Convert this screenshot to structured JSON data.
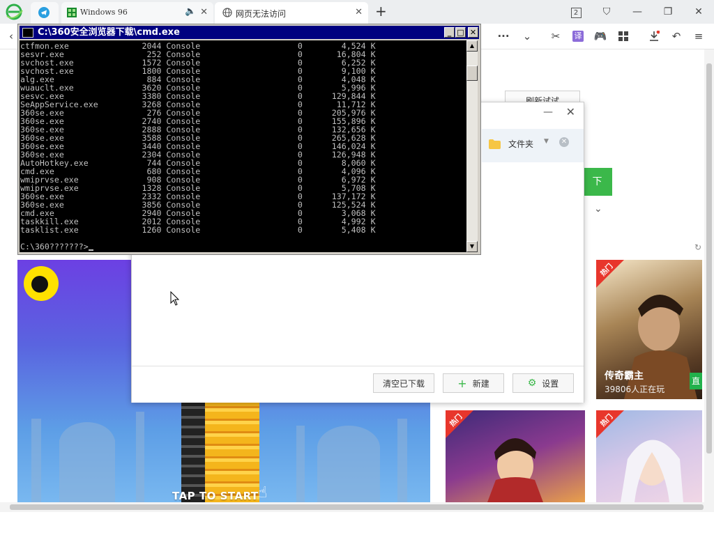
{
  "browser": {
    "tabs": [
      {
        "label": "",
        "icon": "telegram-icon"
      },
      {
        "label": "Windows 96",
        "icon": "win96-icon"
      },
      {
        "label": "网页无法访问",
        "icon": "globe-icon"
      }
    ],
    "tab_count_badge": "2"
  },
  "page": {
    "refresh_label": "刷新试试",
    "green_button_label": "下",
    "game": {
      "tap_label": "TAP TO START"
    },
    "cards": [
      {
        "badge": "热门",
        "title": "传奇霸主",
        "subtitle": "39806人正在玩",
        "tag": "直"
      },
      {
        "badge": "热门"
      },
      {
        "badge": "热门"
      }
    ]
  },
  "download_dialog": {
    "folder_label": "文件夹",
    "clear_button": "清空已下载",
    "new_button": "新建",
    "settings_button": "设置"
  },
  "cmd": {
    "title": "C:\\360安全浏览器下载\\cmd.exe",
    "rows": [
      {
        "name": "ctfmon.exe",
        "pid": "2044",
        "session": "Console",
        "num": "0",
        "mem": "4,524 K"
      },
      {
        "name": "sesvr.exe",
        "pid": "252",
        "session": "Console",
        "num": "0",
        "mem": "16,804 K"
      },
      {
        "name": "svchost.exe",
        "pid": "1572",
        "session": "Console",
        "num": "0",
        "mem": "6,252 K"
      },
      {
        "name": "svchost.exe",
        "pid": "1800",
        "session": "Console",
        "num": "0",
        "mem": "9,100 K"
      },
      {
        "name": "alg.exe",
        "pid": "884",
        "session": "Console",
        "num": "0",
        "mem": "4,048 K"
      },
      {
        "name": "wuauclt.exe",
        "pid": "3620",
        "session": "Console",
        "num": "0",
        "mem": "5,996 K"
      },
      {
        "name": "sesvc.exe",
        "pid": "3380",
        "session": "Console",
        "num": "0",
        "mem": "129,844 K"
      },
      {
        "name": "SeAppService.exe",
        "pid": "3268",
        "session": "Console",
        "num": "0",
        "mem": "11,712 K"
      },
      {
        "name": "360se.exe",
        "pid": "276",
        "session": "Console",
        "num": "0",
        "mem": "205,976 K"
      },
      {
        "name": "360se.exe",
        "pid": "2740",
        "session": "Console",
        "num": "0",
        "mem": "155,896 K"
      },
      {
        "name": "360se.exe",
        "pid": "2888",
        "session": "Console",
        "num": "0",
        "mem": "132,656 K"
      },
      {
        "name": "360se.exe",
        "pid": "3588",
        "session": "Console",
        "num": "0",
        "mem": "265,628 K"
      },
      {
        "name": "360se.exe",
        "pid": "3440",
        "session": "Console",
        "num": "0",
        "mem": "146,024 K"
      },
      {
        "name": "360se.exe",
        "pid": "2304",
        "session": "Console",
        "num": "0",
        "mem": "126,948 K"
      },
      {
        "name": "AutoHotkey.exe",
        "pid": "744",
        "session": "Console",
        "num": "0",
        "mem": "8,060 K"
      },
      {
        "name": "cmd.exe",
        "pid": "680",
        "session": "Console",
        "num": "0",
        "mem": "4,096 K"
      },
      {
        "name": "wmiprvse.exe",
        "pid": "908",
        "session": "Console",
        "num": "0",
        "mem": "6,972 K"
      },
      {
        "name": "wmiprvse.exe",
        "pid": "1328",
        "session": "Console",
        "num": "0",
        "mem": "5,708 K"
      },
      {
        "name": "360se.exe",
        "pid": "2332",
        "session": "Console",
        "num": "0",
        "mem": "137,172 K"
      },
      {
        "name": "360se.exe",
        "pid": "3856",
        "session": "Console",
        "num": "0",
        "mem": "125,524 K"
      },
      {
        "name": "cmd.exe",
        "pid": "2940",
        "session": "Console",
        "num": "0",
        "mem": "3,068 K"
      },
      {
        "name": "taskkill.exe",
        "pid": "2012",
        "session": "Console",
        "num": "0",
        "mem": "4,992 K"
      },
      {
        "name": "tasklist.exe",
        "pid": "1260",
        "session": "Console",
        "num": "0",
        "mem": "5,408 K"
      }
    ],
    "prompt": "C:\\360???????>"
  }
}
